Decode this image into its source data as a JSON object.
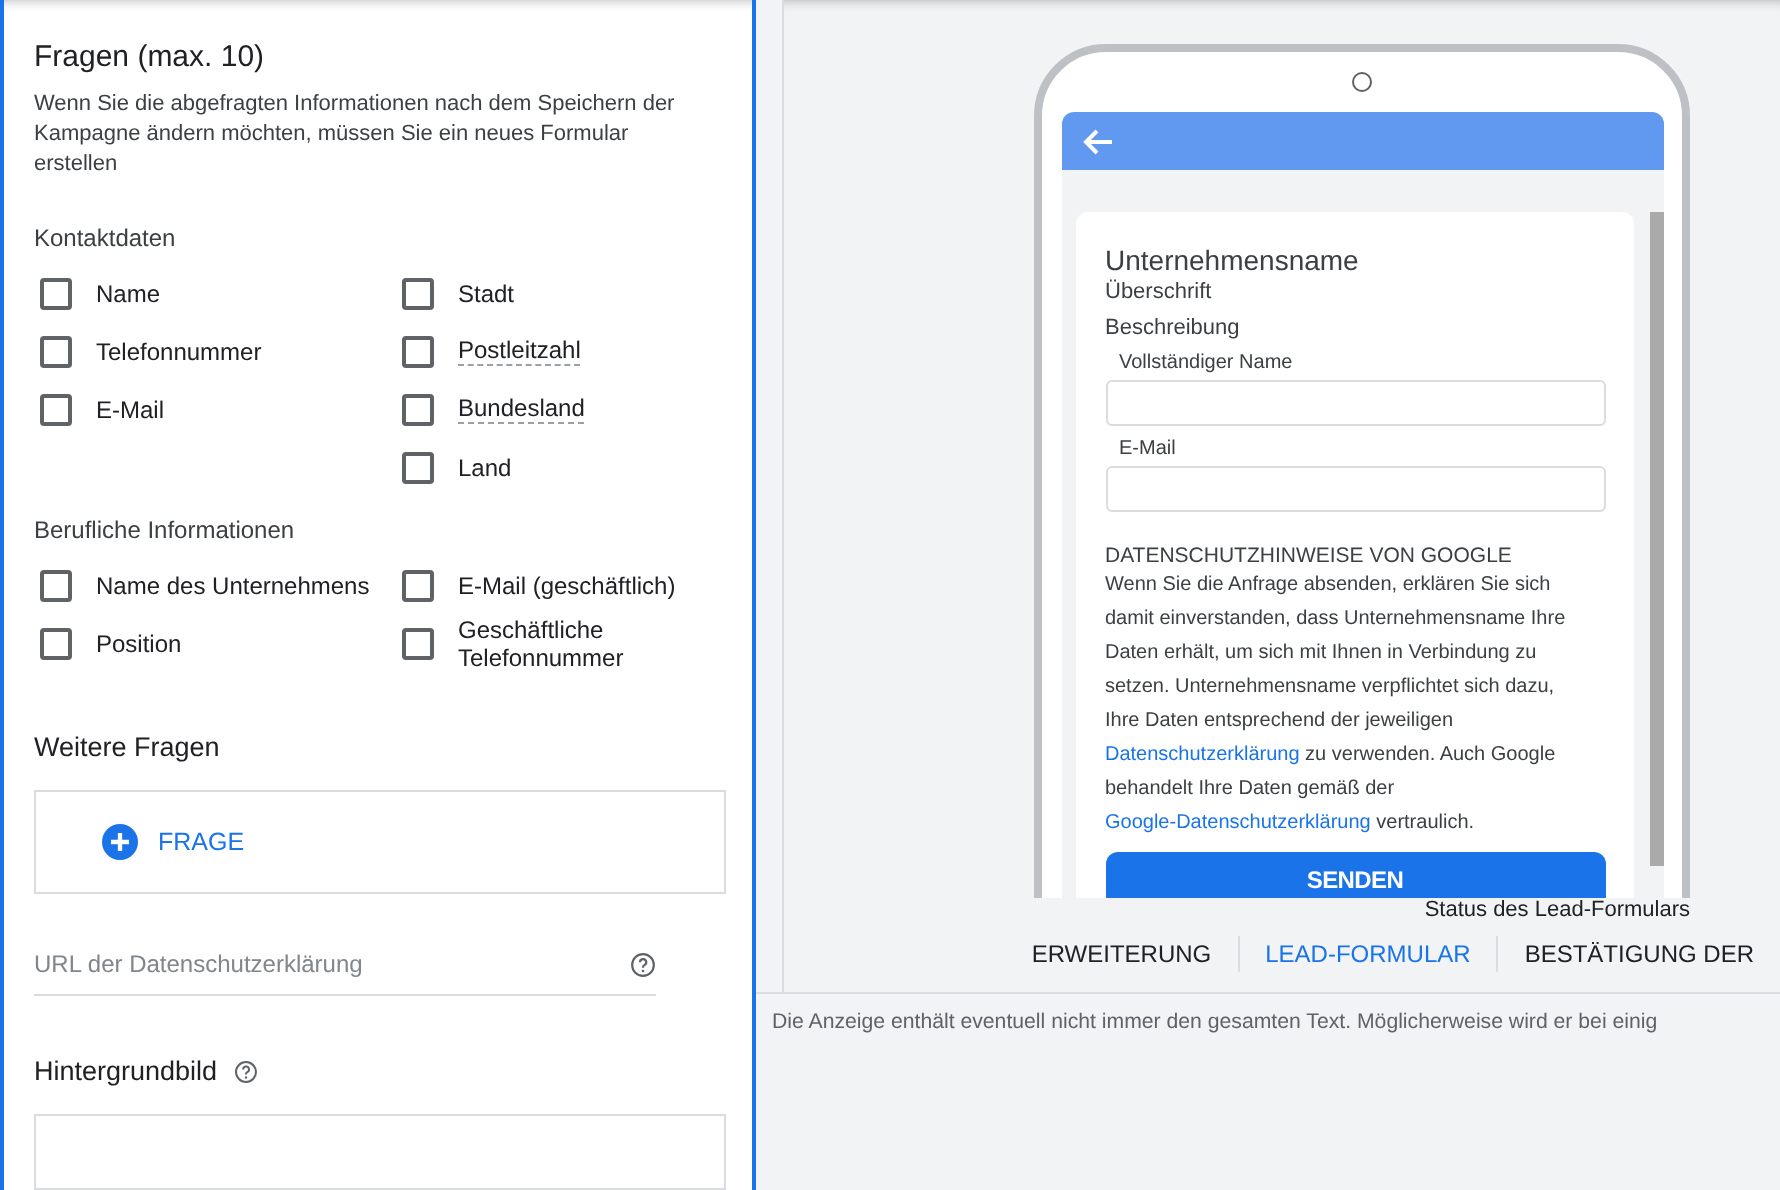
{
  "questions": {
    "title": "Fragen (max. 10)",
    "hint": "Wenn Sie die abgefragten Informationen nach dem Speichern der Kampagne ändern möchten, müssen Sie ein neues Formular erstellen",
    "groups": [
      {
        "title": "Kontaktdaten",
        "columns": [
          [
            {
              "label": "Name",
              "checked": false,
              "underlined": false
            },
            {
              "label": "Telefonnummer",
              "checked": false,
              "underlined": false
            },
            {
              "label": "E-Mail",
              "checked": false,
              "underlined": false
            }
          ],
          [
            {
              "label": "Stadt",
              "checked": false,
              "underlined": false
            },
            {
              "label": "Postleitzahl",
              "checked": false,
              "underlined": true
            },
            {
              "label": "Bundesland",
              "checked": false,
              "underlined": true
            },
            {
              "label": "Land",
              "checked": false,
              "underlined": false
            }
          ]
        ]
      },
      {
        "title": "Berufliche Informationen",
        "columns": [
          [
            {
              "label": "Name des Unternehmens",
              "checked": false,
              "underlined": false
            },
            {
              "label": "Position",
              "checked": false,
              "underlined": false
            }
          ],
          [
            {
              "label": "E-Mail (geschäftlich)",
              "checked": false,
              "underlined": false
            },
            {
              "label": "Geschäftliche Telefonnummer",
              "checked": false,
              "underlined": false
            }
          ]
        ]
      }
    ]
  },
  "more_questions": {
    "title": "Weitere Fragen",
    "add_button": "FRAGE"
  },
  "privacy_url": {
    "placeholder": "URL der Datenschutzerklärung"
  },
  "background_image": {
    "title": "Hintergrundbild"
  },
  "preview": {
    "company": "Unternehmensname",
    "headline": "Überschrift",
    "description": "Beschreibung",
    "fields": [
      {
        "label": "Vollständiger Name"
      },
      {
        "label": "E-Mail"
      }
    ],
    "privacy_title": "DATENSCHUTZHINWEISE VON GOOGLE",
    "privacy_text": [
      {
        "kind": "text",
        "text": "Wenn Sie die Anfrage absenden, erklären Sie sich damit einverstanden, dass Unternehmensname Ihre Daten erhält, um sich mit Ihnen in Verbindung zu setzen. Unternehmensname verpflichtet sich dazu, Ihre Daten entsprechend der jeweiligen "
      },
      {
        "kind": "link",
        "text": "Datenschutzerklärung"
      },
      {
        "kind": "text",
        "text": " zu verwenden. Auch Google behandelt Ihre Daten gemäß der "
      },
      {
        "kind": "link",
        "text": "Google-Datenschutzerklärung"
      },
      {
        "kind": "text",
        "text": " vertraulich."
      }
    ],
    "submit": "SENDEN"
  },
  "status_label": "Status des Lead-Formulars",
  "tabs": [
    {
      "label": "ERWEITERUNG",
      "selected": false
    },
    {
      "label": "LEAD-FORMULAR",
      "selected": true
    },
    {
      "label": "BESTÄTIGUNG DER",
      "selected": false
    }
  ],
  "note": "Die Anzeige enthält eventuell nicht immer den gesamten Text. Möglicherweise wird er bei einig"
}
